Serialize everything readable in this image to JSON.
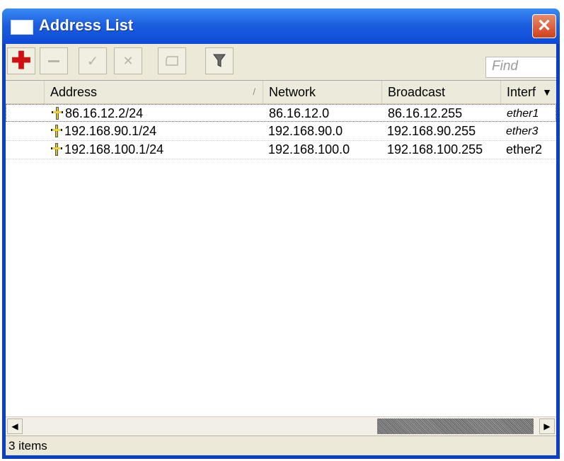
{
  "window": {
    "title": "Address List",
    "close_label": "✕"
  },
  "toolbar": {
    "buttons": [
      "add",
      "remove",
      "enable",
      "disable",
      "comment",
      "filter"
    ],
    "find_placeholder": "Find"
  },
  "table": {
    "columns": [
      "Address",
      "Network",
      "Broadcast",
      "Interf..."
    ],
    "columns_display": [
      "Address",
      "Network",
      "Broadcast",
      "Interf"
    ],
    "sort_indicator": "/",
    "rows": [
      {
        "address": "86.16.12.2/24",
        "network": "86.16.12.0",
        "broadcast": "86.16.12.255",
        "interface": "ether1",
        "dynamic": true
      },
      {
        "address": "192.168.90.1/24",
        "network": "192.168.90.0",
        "broadcast": "192.168.90.255",
        "interface": "ether3",
        "dynamic": true
      },
      {
        "address": "192.168.100.1/24",
        "network": "192.168.100.0",
        "broadcast": "192.168.100.255",
        "interface": "ether2",
        "dynamic": false
      }
    ]
  },
  "status": {
    "item_count": "3 items"
  },
  "colors": {
    "titlebar": "#0d4ad6",
    "window_bg": "#ece9d8",
    "add_icon": "#d01010",
    "close_button": "#d0401a"
  }
}
